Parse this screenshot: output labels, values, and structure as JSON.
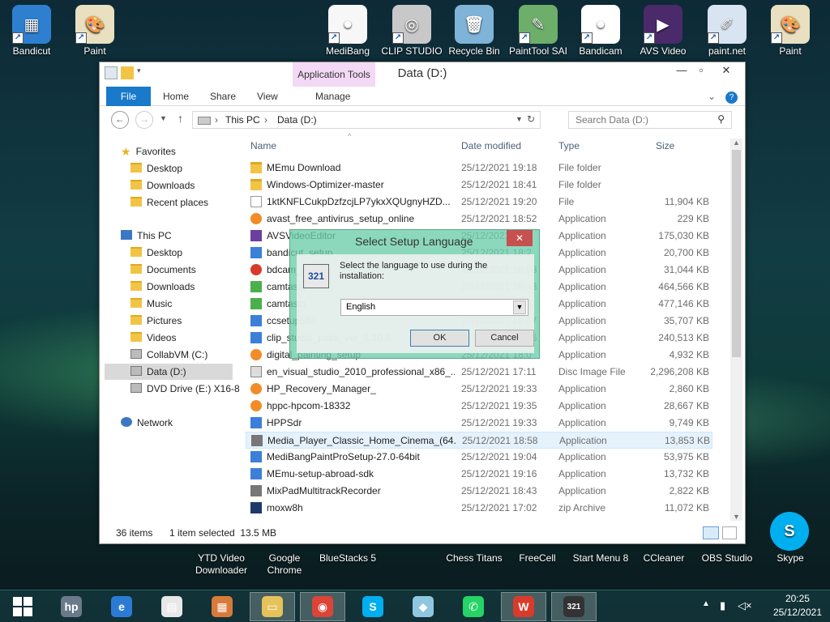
{
  "desktop": {
    "top_icons": [
      {
        "label": "Bandicut",
        "color": "#2f7fd0",
        "glyph": "▦"
      },
      {
        "label": "Paint",
        "color": "#e8e0c0",
        "glyph": "🎨"
      },
      {
        "label": "MediBang",
        "color": "#f7f7f7",
        "glyph": "●"
      },
      {
        "label": "CLIP STUDIO",
        "color": "#c8c8c8",
        "glyph": "◎"
      },
      {
        "label": "Recycle Bin",
        "color": "#7fb3d8",
        "glyph": "🗑"
      },
      {
        "label": "PaintTool SAI",
        "color": "#6cae6a",
        "glyph": "✎"
      },
      {
        "label": "Bandicam",
        "color": "#ffffff",
        "glyph": "●"
      },
      {
        "label": "AVS Video",
        "color": "#4a2a6a",
        "glyph": "▶"
      },
      {
        "label": "paint.net",
        "color": "#d8e4f2",
        "glyph": "✐"
      },
      {
        "label": "Paint",
        "color": "#e8e0c0",
        "glyph": "🎨"
      }
    ],
    "bottom_icons": [
      {
        "label": "YTD Video\nDownloader"
      },
      {
        "label": "Google\nChrome"
      },
      {
        "label": "BlueStacks 5"
      },
      {
        "label": "Chess Titans"
      },
      {
        "label": "FreeCell"
      },
      {
        "label": "Start Menu 8"
      },
      {
        "label": "CCleaner"
      },
      {
        "label": "OBS Studio"
      },
      {
        "label": "Skype"
      }
    ]
  },
  "window": {
    "title": "Data (D:)",
    "contextual_tab_group": "Application Tools",
    "tabs": [
      "File",
      "Home",
      "Share",
      "View",
      "Manage"
    ],
    "breadcrumb": [
      "This PC",
      "Data (D:)"
    ],
    "search_placeholder": "Search Data (D:)",
    "nav": {
      "favorites_label": "Favorites",
      "favorites": [
        "Desktop",
        "Downloads",
        "Recent places"
      ],
      "thispc_label": "This PC",
      "thispc": [
        "Desktop",
        "Documents",
        "Downloads",
        "Music",
        "Pictures",
        "Videos",
        "CollabVM (C:)",
        "Data (D:)",
        "DVD Drive (E:) X16-8"
      ],
      "network_label": "Network"
    },
    "columns": {
      "name": "Name",
      "date": "Date modified",
      "type": "Type",
      "size": "Size"
    },
    "files": [
      {
        "name": "MEmu Download",
        "date": "25/12/2021 19:18",
        "type": "File folder",
        "size": "",
        "icon": "folder"
      },
      {
        "name": "Windows-Optimizer-master",
        "date": "25/12/2021 18:41",
        "type": "File folder",
        "size": "",
        "icon": "folder"
      },
      {
        "name": "1ktKNFLCukpDzfzcjLP7ykxXQUgnyHZD...",
        "date": "25/12/2021 19:20",
        "type": "File",
        "size": "11,904 KB",
        "icon": "file"
      },
      {
        "name": "avast_free_antivirus_setup_online",
        "date": "25/12/2021 18:52",
        "type": "Application",
        "size": "229 KB",
        "icon": "app-orange"
      },
      {
        "name": "AVSVideoEditor",
        "date": "25/12/2021 18:5",
        "type": "Application",
        "size": "175,030 KB",
        "icon": "app-purple"
      },
      {
        "name": "bandicut_setup",
        "date": "25/12/2021 18:2",
        "type": "Application",
        "size": "20,700 KB",
        "icon": "app-blue"
      },
      {
        "name": "bdcam_setup",
        "date": "25/12/2021 18:08",
        "type": "Application",
        "size": "31,044 KB",
        "icon": "app-red"
      },
      {
        "name": "camtasia",
        "date": "25/12/2021 18:43",
        "type": "Application",
        "size": "464,566 KB",
        "icon": "app-green"
      },
      {
        "name": "camtasia",
        "date": "25/12/2021 18:3",
        "type": "Application",
        "size": "477,146 KB",
        "icon": "app-green"
      },
      {
        "name": "ccsetup588",
        "date": "25/12/2021 18:57",
        "type": "Application",
        "size": "35,707 KB",
        "icon": "app-blue"
      },
      {
        "name": "clip_studio_paint_ver_1.10.8",
        "date": "25/12/2021 18:56",
        "type": "Application",
        "size": "240,513 KB",
        "icon": "app-blue"
      },
      {
        "name": "digital_painting_setup",
        "date": "25/12/2021 18:0",
        "type": "Application",
        "size": "4,932 KB",
        "icon": "app-orange"
      },
      {
        "name": "en_visual_studio_2010_professional_x86_...",
        "date": "25/12/2021 17:11",
        "type": "Disc Image File",
        "size": "2,296,208 KB",
        "icon": "disc"
      },
      {
        "name": "HP_Recovery_Manager_",
        "date": "25/12/2021 19:33",
        "type": "Application",
        "size": "2,860 KB",
        "icon": "app-orange"
      },
      {
        "name": "hppc-hpcom-18332",
        "date": "25/12/2021 19:35",
        "type": "Application",
        "size": "28,667 KB",
        "icon": "app-orange"
      },
      {
        "name": "HPPSdr",
        "date": "25/12/2021 19:33",
        "type": "Application",
        "size": "9,749 KB",
        "icon": "app-blue"
      },
      {
        "name": "Media_Player_Classic_Home_Cinema_(64...",
        "date": "25/12/2021 18:58",
        "type": "Application",
        "size": "13,853 KB",
        "icon": "app-gray",
        "selected": true
      },
      {
        "name": "MediBangPaintProSetup-27.0-64bit",
        "date": "25/12/2021 19:04",
        "type": "Application",
        "size": "53,975 KB",
        "icon": "app-blue"
      },
      {
        "name": "MEmu-setup-abroad-sdk",
        "date": "25/12/2021 19:16",
        "type": "Application",
        "size": "13,732 KB",
        "icon": "app-blue"
      },
      {
        "name": "MixPadMultitrackRecorder",
        "date": "25/12/2021 18:43",
        "type": "Application",
        "size": "2,822 KB",
        "icon": "app-gray"
      },
      {
        "name": "moxw8h",
        "date": "25/12/2021 17:02",
        "type": "zip Archive",
        "size": "11,072 KB",
        "icon": "zip"
      }
    ],
    "status": {
      "count": "36 items",
      "selection": "1 item selected  13.5 MB"
    }
  },
  "dialog": {
    "title": "Select Setup Language",
    "message": "Select the language to use during the installation:",
    "selected_language": "English",
    "ok_label": "OK",
    "cancel_label": "Cancel"
  },
  "taskbar": {
    "time": "20:25",
    "date": "25/12/2021",
    "apps": [
      {
        "name": "hp",
        "color": "#6a7a8a",
        "glyph": "hp"
      },
      {
        "name": "ie",
        "color": "#2b7bd4",
        "glyph": "e"
      },
      {
        "name": "doc",
        "color": "#e8e8e8",
        "glyph": "▤"
      },
      {
        "name": "media",
        "color": "#d87a3a",
        "glyph": "▦"
      },
      {
        "name": "explorer",
        "color": "#e5c25a",
        "glyph": "▭"
      },
      {
        "name": "chrome",
        "color": "#db4437",
        "glyph": "◉"
      },
      {
        "name": "skype",
        "color": "#00aff0",
        "glyph": "S"
      },
      {
        "name": "glass",
        "color": "#8fc7e0",
        "glyph": "◆"
      },
      {
        "name": "whatsapp",
        "color": "#25d366",
        "glyph": "✆"
      },
      {
        "name": "wps",
        "color": "#d83b2b",
        "glyph": "W"
      },
      {
        "name": "mpc",
        "color": "#333333",
        "glyph": "321"
      }
    ]
  }
}
